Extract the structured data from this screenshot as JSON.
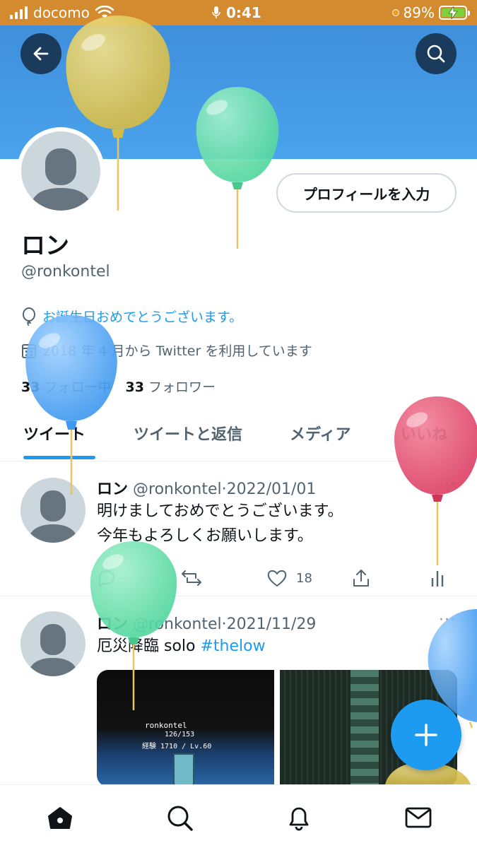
{
  "status_bar": {
    "carrier": "docomo",
    "time": "0:41",
    "battery": "89%",
    "colors": {
      "bar": "#d48a2e",
      "battery_fill": "#7cd23c"
    }
  },
  "header": {
    "back_icon": "arrow-left-icon",
    "search_icon": "search-icon",
    "banner_color": "#4aa3ec"
  },
  "profile": {
    "name": "ロン",
    "handle": "@ronkontel",
    "edit_button": "プロフィールを入力",
    "birthday_text": "お誕生日おめでとうございます。",
    "joined_text": "2018 年 4 月から Twitter を利用しています",
    "following_count": "33",
    "following_label": "フォロー中",
    "followers_count": "33",
    "followers_label": "フォロワー"
  },
  "tabs": [
    {
      "label": "ツイート",
      "active": true
    },
    {
      "label": "ツイートと返信",
      "active": false
    },
    {
      "label": "メディア",
      "active": false
    },
    {
      "label": "いいね",
      "active": false
    }
  ],
  "tweets": [
    {
      "name": "ロン",
      "handle": "@ronkontel",
      "date": "2022/01/01",
      "line1": "明けましておめでとうございます。",
      "line2": "今年もよろしくお願いします。",
      "likes": "18"
    },
    {
      "name": "ロン",
      "handle": "@ronkontel",
      "date": "2021/11/29",
      "text": "厄災降臨 solo ",
      "hashtag": "#thelow",
      "game_name": "ronkontel",
      "game_hp": "126/153",
      "game_status": "経験 1710 / Lv.60"
    }
  ],
  "fab_icon": "plus-icon",
  "nav": [
    "home-icon",
    "explore-search-icon",
    "notifications-bell-icon",
    "messages-envelope-icon"
  ],
  "accent_color": "#1d9bf0"
}
